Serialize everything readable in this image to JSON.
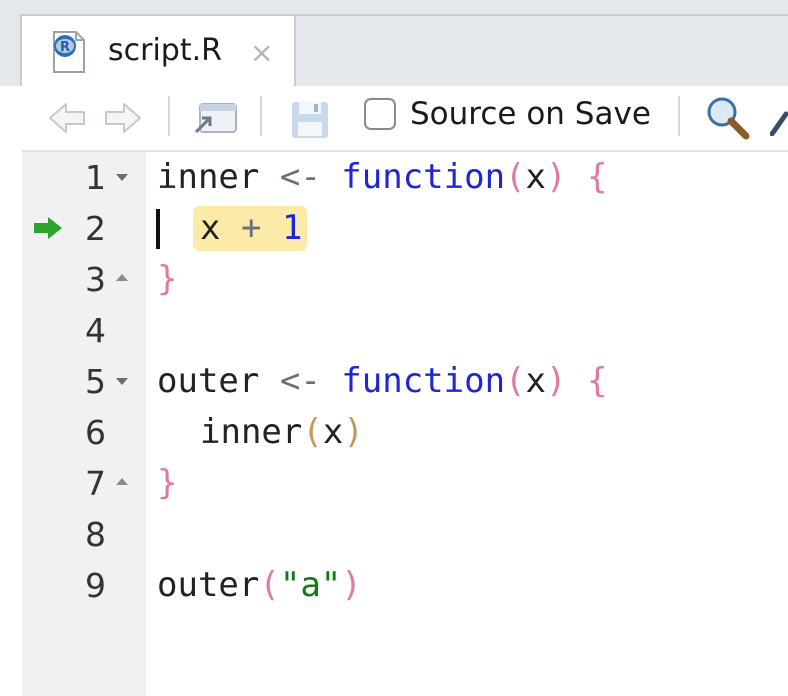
{
  "tab": {
    "file_name": "script.R",
    "close_symbol": "×",
    "icon": "r-file-icon",
    "icon_letter": "R"
  },
  "toolbar": {
    "back_icon": "back-arrow-icon",
    "forward_icon": "forward-arrow-icon",
    "show_in_window_icon": "show-in-new-window-icon",
    "save_icon": "save-icon",
    "source_on_save_label": "Source on Save",
    "source_on_save_checked": false,
    "search_icon": "search-icon",
    "code_tools_icon": "wand-icon"
  },
  "editor": {
    "current_line": 2,
    "breakpoint_arrow_color": "#2da32d",
    "highlight_color": "#fbeaa8",
    "lines": [
      {
        "number": "1",
        "fold": "open"
      },
      {
        "number": "2",
        "fold": ""
      },
      {
        "number": "3",
        "fold": "close"
      },
      {
        "number": "4",
        "fold": ""
      },
      {
        "number": "5",
        "fold": "open"
      },
      {
        "number": "6",
        "fold": ""
      },
      {
        "number": "7",
        "fold": "close"
      },
      {
        "number": "8",
        "fold": ""
      },
      {
        "number": "9",
        "fold": ""
      }
    ],
    "tokens": {
      "l1_name": "inner",
      "l1_assign": "<-",
      "l1_kw": "function",
      "l1_paren_open": "(",
      "l1_arg": "x",
      "l1_paren_close": ")",
      "l1_brace": "{",
      "l2_var": "x",
      "l2_op": "+",
      "l2_num": "1",
      "l3_brace": "}",
      "l5_name": "outer",
      "l5_assign": "<-",
      "l5_kw": "function",
      "l5_paren_open": "(",
      "l5_arg": "x",
      "l5_paren_close": ")",
      "l5_brace": "{",
      "l6_call": "inner",
      "l6_paren_open": "(",
      "l6_arg": "x",
      "l6_paren_close": ")",
      "l7_brace": "}",
      "l9_call": "outer",
      "l9_paren_open": "(",
      "l9_str": "\"a\"",
      "l9_paren_close": ")"
    }
  }
}
